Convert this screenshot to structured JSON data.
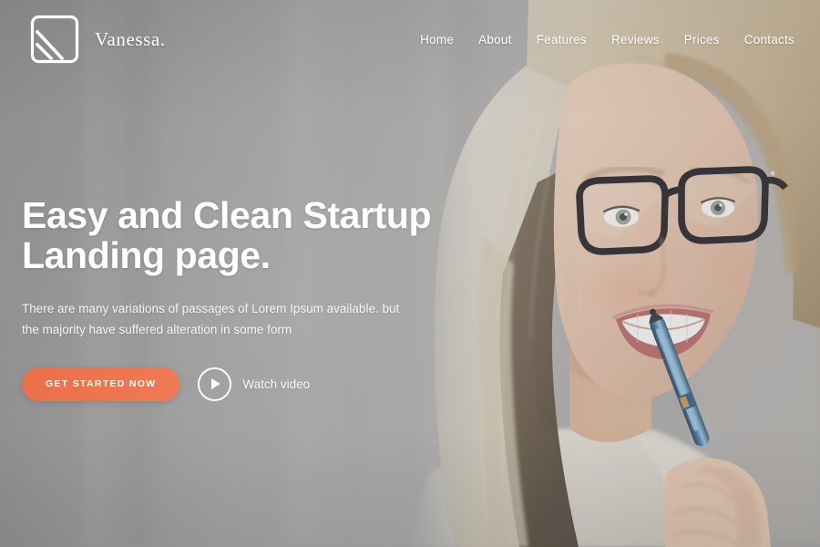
{
  "brand": {
    "name": "Vanessa.",
    "logo_icon": "square-diagonal-stripes-logo"
  },
  "nav": {
    "items": [
      {
        "label": "Home",
        "active": true
      },
      {
        "label": "About",
        "active": false
      },
      {
        "label": "Features",
        "active": false
      },
      {
        "label": "Reviews",
        "active": false
      },
      {
        "label": "Prices",
        "active": false
      },
      {
        "label": "Contacts",
        "active": false
      }
    ]
  },
  "hero": {
    "headline_line1": "Easy and Clean Startup",
    "headline_line2": "Landing page.",
    "subcopy_line1": "There are many variations of passages of Lorem Ipsum available. but",
    "subcopy_line2": "the majority have suffered alteration in some form",
    "cta_label": "GET STARTED NOW",
    "watch_label": "Watch video",
    "play_icon": "play-triangle-icon",
    "image_alt": "smiling blonde woman wearing black glasses holding a blue pen"
  },
  "colors": {
    "accent": "#E8704A",
    "accent_light": "#F07A55",
    "text_on_image": "#FFFFFF",
    "overlay_gray": "#8E8E8E"
  }
}
